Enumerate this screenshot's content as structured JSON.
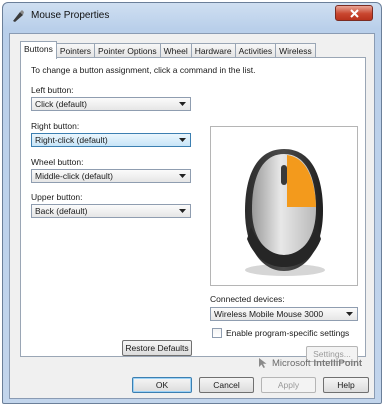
{
  "window": {
    "title": "Mouse Properties"
  },
  "tabs": [
    "Buttons",
    "Pointers",
    "Pointer Options",
    "Wheel",
    "Hardware",
    "Activities",
    "Wireless"
  ],
  "buttons_tab": {
    "instruction": "To change a button assignment, click a command in the list.",
    "left_button": {
      "label": "Left button:",
      "value": "Click (default)"
    },
    "right_button": {
      "label": "Right button:",
      "value": "Right-click (default)"
    },
    "wheel_button": {
      "label": "Wheel button:",
      "value": "Middle-click (default)"
    },
    "upper_button": {
      "label": "Upper button:",
      "value": "Back (default)"
    },
    "connected_devices": {
      "label": "Connected devices:",
      "value": "Wireless Mobile Mouse 3000"
    },
    "program_specific": {
      "label": "Enable program-specific settings",
      "checked": false
    },
    "settings_label": "Settings...",
    "restore_defaults_label": "Restore Defaults",
    "brand": {
      "company": "Microsoft",
      "product": "IntelliPoint"
    },
    "highlight_color": "#f39a1c"
  },
  "footer": {
    "ok": "OK",
    "cancel": "Cancel",
    "apply": "Apply",
    "help": "Help"
  },
  "icons": [
    "mouse-pointer-icon",
    "close-icon",
    "dropdown-arrow-icon",
    "mouse-device-image",
    "intellipoint-cursor-icon"
  ]
}
